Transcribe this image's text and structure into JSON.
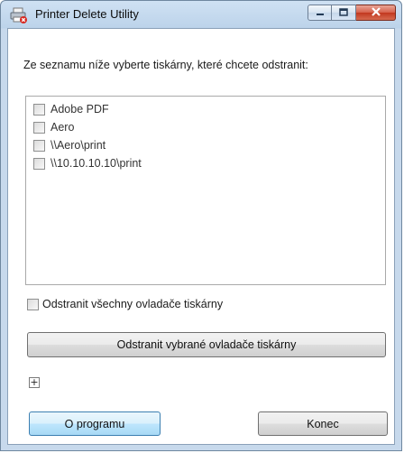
{
  "window": {
    "title": "Printer Delete Utility",
    "controls": [
      "minimize-icon",
      "maximize-icon",
      "close-icon"
    ]
  },
  "main": {
    "instruction": "Ze seznamu níže vyberte tiskárny, které chcete odstranit:",
    "printers": [
      {
        "label": "Adobe PDF",
        "checked": false
      },
      {
        "label": "Aero",
        "checked": false
      },
      {
        "label": "\\\\Aero\\print",
        "checked": false
      },
      {
        "label": "\\\\10.10.10.10\\print",
        "checked": false
      }
    ],
    "remove_all_drivers_label": "Odstranit všechny ovladače tiskárny",
    "remove_all_drivers_checked": false,
    "remove_selected_button": "Odstranit vybrané ovladače tiskárny",
    "expander_symbol": "+"
  },
  "footer": {
    "about_button": "O programu",
    "close_button": "Konec"
  },
  "colors": {
    "title_bar": "#c7d9ec",
    "close_button": "#c2381f",
    "default_button_border": "#3c7fb1"
  }
}
